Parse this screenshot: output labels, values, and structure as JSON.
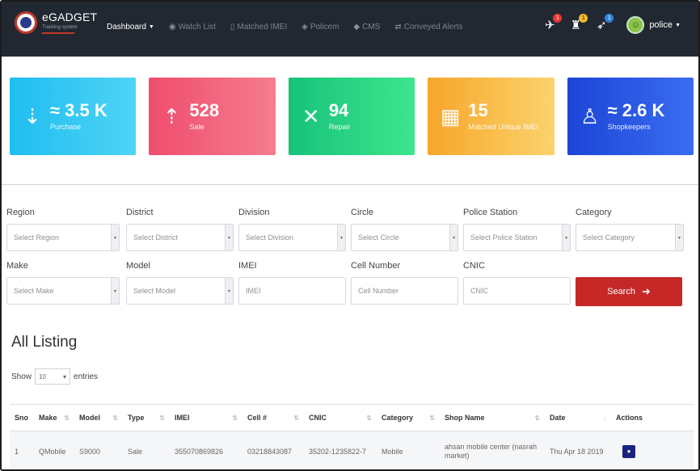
{
  "brand": {
    "title": "eGADGET",
    "subtitle": "Tracking system"
  },
  "nav": {
    "menu": [
      {
        "label": "Dashboard",
        "icon": "none",
        "active": true,
        "dropdown": true
      },
      {
        "label": "Watch List",
        "icon": "binoculars-icon"
      },
      {
        "label": "Matched IMEI",
        "icon": "clipboard-icon"
      },
      {
        "label": "Policem",
        "icon": "shield-icon"
      },
      {
        "label": "CMS",
        "icon": "car-icon"
      },
      {
        "label": "Conveyed Alerts",
        "icon": "exchange-icon"
      }
    ],
    "notifications": [
      {
        "icon": "satellite-icon",
        "count": "1"
      },
      {
        "icon": "badge-icon",
        "count": "1"
      },
      {
        "icon": "rocket-icon",
        "count": "1"
      }
    ],
    "user": {
      "name": "police",
      "icon": "avatar-icon"
    }
  },
  "cards": [
    {
      "value": "≈ 3.5 K",
      "label": "Purchase",
      "icon": "purchase-icon",
      "color": "#1fbdf0"
    },
    {
      "value": "528",
      "label": "Sale",
      "icon": "sale-icon",
      "color": "#ef4d6d"
    },
    {
      "value": "94",
      "label": "Repair",
      "icon": "repair-icon",
      "color": "#17c27a"
    },
    {
      "value": "15",
      "label": "Matched Unique IMEI",
      "icon": "building-icon",
      "color": "#f7a62b"
    },
    {
      "value": "≈ 2.6 K",
      "label": "Shopkeepers",
      "icon": "shopkeeper-icon",
      "color": "#1c45d6"
    }
  ],
  "filters": {
    "row1": [
      {
        "label": "Region",
        "value": "Select Region",
        "type": "select"
      },
      {
        "label": "District",
        "value": "Select District",
        "type": "select"
      },
      {
        "label": "Division",
        "value": "Select Division",
        "type": "select"
      },
      {
        "label": "Circle",
        "value": "Select Circle",
        "type": "select"
      },
      {
        "label": "Police Station",
        "value": "Select Police Station",
        "type": "select"
      },
      {
        "label": "Category",
        "value": "Select Category",
        "type": "select"
      }
    ],
    "row2": [
      {
        "label": "Make",
        "value": "Select Make",
        "type": "select"
      },
      {
        "label": "Model",
        "value": "Select Model",
        "type": "select"
      },
      {
        "label": "IMEI",
        "placeholder": "IMEI",
        "type": "input"
      },
      {
        "label": "Cell Number",
        "placeholder": "Cell Number",
        "type": "input"
      },
      {
        "label": "CNIC",
        "placeholder": "CNIC",
        "type": "input"
      }
    ],
    "search_label": "Search",
    "search_color": "#c62828"
  },
  "listing": {
    "title": "All Listing",
    "show_label": "Show",
    "entries_value": "10",
    "entries_label": "entries",
    "columns": [
      "Sno",
      "Make",
      "Model",
      "Type",
      "IMEI",
      "Cell #",
      "CNIC",
      "Category",
      "Shop Name",
      "Date",
      "Actions"
    ],
    "rows": [
      [
        "1",
        "QMobile",
        "S9000",
        "Sale",
        "355070869826",
        "03218843087",
        "35202-1235822-7",
        "Mobile",
        "ahsan mobile center (nasrah market)",
        "Thu Apr 18 2019",
        ""
      ]
    ]
  }
}
